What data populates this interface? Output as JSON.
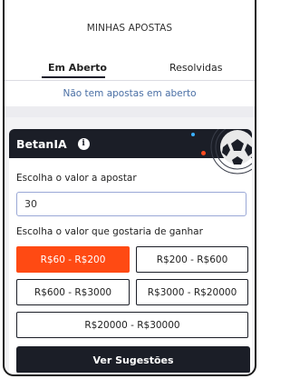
{
  "header": {
    "title": "MINHAS APOSTAS"
  },
  "tabs": [
    {
      "label": "Em Aberto",
      "active": true
    },
    {
      "label": "Resolvidas",
      "active": false
    }
  ],
  "empty_message": "Não tem apostas em aberto",
  "betania": {
    "title": "BetanIA",
    "info_icon": "info-icon",
    "stake_label": "Escolha o valor a apostar",
    "stake_value": "30",
    "win_label": "Escolha o valor que gostaria de ganhar",
    "ranges": [
      {
        "label": "R$60 - R$200",
        "selected": true
      },
      {
        "label": "R$200 - R$600",
        "selected": false
      },
      {
        "label": "R$600 - R$3000",
        "selected": false
      },
      {
        "label": "R$3000 - R$20000",
        "selected": false
      },
      {
        "label": "R$20000 - R$30000",
        "selected": false
      }
    ],
    "cta_label": "Ver Sugestões"
  },
  "colors": {
    "accent": "#ff4a13",
    "dark": "#1b1e27",
    "link_text": "#4a6fa5"
  }
}
